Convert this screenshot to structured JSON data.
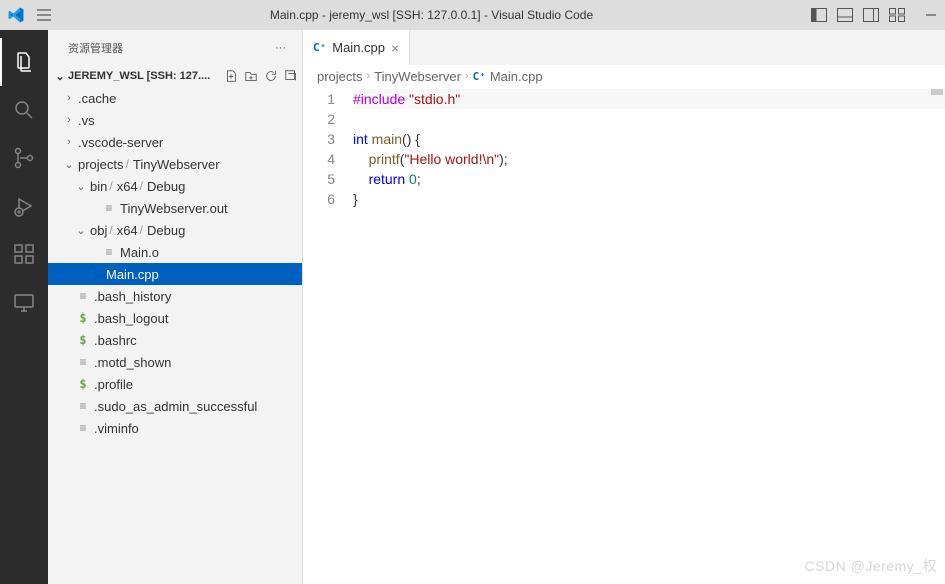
{
  "titlebar": {
    "title": "Main.cpp - jeremy_wsl [SSH: 127.0.0.1] - Visual Studio Code"
  },
  "sidebar": {
    "title": "资源管理器",
    "workspace": "JEREMY_WSL [SSH: 127....",
    "tree": {
      "cache": ".cache",
      "vs": ".vs",
      "vscode_server": ".vscode-server",
      "projects": "projects",
      "tinywebserver": "TinyWebserver",
      "bin": "bin",
      "x64": "x64",
      "debug": "Debug",
      "tinywebserver_out": "TinyWebserver.out",
      "obj": "obj",
      "main_o": "Main.o",
      "main_cpp": "Main.cpp",
      "bash_history": ".bash_history",
      "bash_logout": ".bash_logout",
      "bashrc": ".bashrc",
      "motd_shown": ".motd_shown",
      "profile": ".profile",
      "sudo_as_admin": ".sudo_as_admin_successful",
      "viminfo": ".viminfo"
    }
  },
  "tabs": {
    "main_cpp": "Main.cpp"
  },
  "breadcrumbs": {
    "projects": "projects",
    "tinywebserver": "TinyWebserver",
    "file": "Main.cpp"
  },
  "code": {
    "lines": [
      "1",
      "2",
      "3",
      "4",
      "5",
      "6"
    ],
    "l1_include": "#include",
    "l1_string": " \"stdio.h\"",
    "l3_type": "int",
    "l3_func": " main",
    "l3_rest": "() {",
    "l4_indent": "    ",
    "l4_func": "printf",
    "l4_paren_open": "(",
    "l4_string": "\"Hello world!\\n\"",
    "l4_paren_close": ");",
    "l5_indent": "    ",
    "l5_keyword": "return",
    "l5_space": " ",
    "l5_num": "0",
    "l5_semi": ";",
    "l6": "}"
  },
  "watermark": "CSDN @Jeremy_权"
}
